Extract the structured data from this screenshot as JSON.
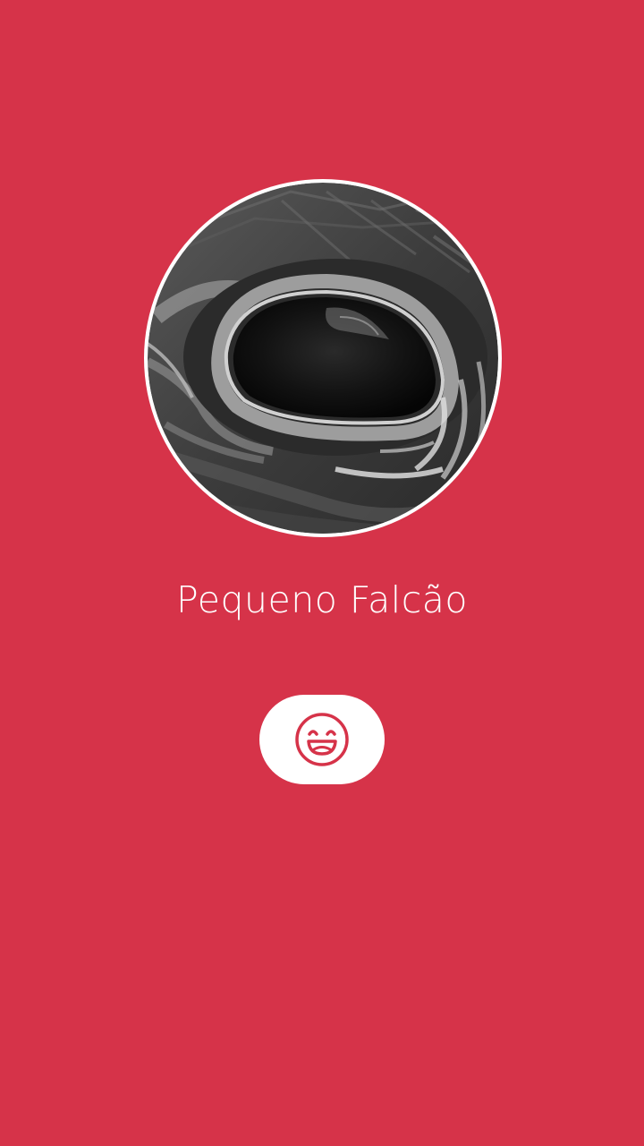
{
  "profile": {
    "name": "Pequeno Falcão",
    "avatar_icon": "bird-eye-photo"
  },
  "action": {
    "icon": "laughing-face-icon"
  },
  "colors": {
    "background": "#d63349",
    "accent": "#d63349",
    "button_bg": "#ffffff",
    "text": "#ffffff"
  }
}
